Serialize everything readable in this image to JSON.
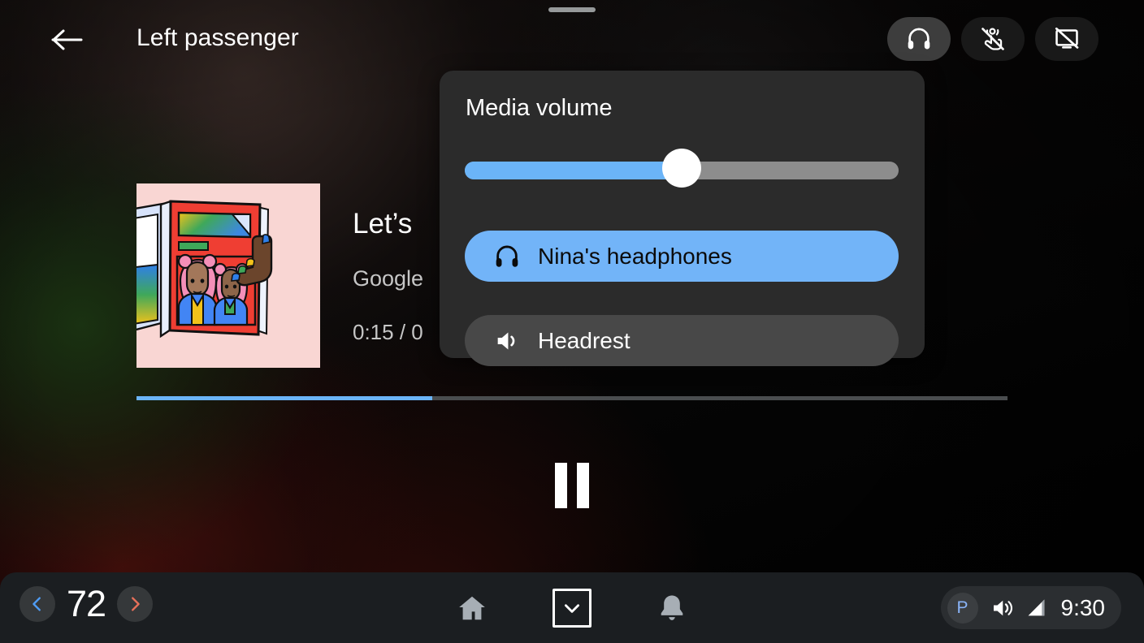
{
  "header": {
    "back_icon": "arrow-left-icon",
    "title": "Left passenger",
    "actions": [
      {
        "name": "headphones-toggle",
        "icon": "headphones-icon",
        "active": true
      },
      {
        "name": "touch-off-toggle",
        "icon": "touch-off-icon",
        "active": false
      },
      {
        "name": "screen-off-toggle",
        "icon": "screen-off-icon",
        "active": false
      }
    ]
  },
  "media": {
    "album_art_alt": "album-artwork",
    "track_title": "Let’s",
    "artist": "Google",
    "time": "0:15 / 0",
    "progress_percent": 34,
    "transport": {
      "state": "playing",
      "button": "pause-button"
    }
  },
  "volume_popup": {
    "title": "Media volume",
    "slider": {
      "value_percent": 50
    },
    "devices": [
      {
        "label": "Nina's headphones",
        "icon": "headphones-icon",
        "selected": true
      },
      {
        "label": "Headrest",
        "icon": "speaker-icon",
        "selected": false
      }
    ]
  },
  "bottom_bar": {
    "temperature": {
      "decrease_label": "‹",
      "value": "72",
      "increase_label": "›"
    },
    "nav": [
      {
        "name": "home-button",
        "icon": "home-icon"
      },
      {
        "name": "collapse-button",
        "icon": "chevron-down-icon",
        "focused": true
      },
      {
        "name": "notifications-button",
        "icon": "bell-icon"
      }
    ],
    "status": {
      "profile_initial": "P",
      "volume_icon": "volume-icon",
      "signal_icon": "signal-icon",
      "clock": "9:30"
    }
  },
  "colors": {
    "accent_blue": "#6bb4f8",
    "selected_blue": "#72b4f8",
    "panel_bg": "#2b2b2b",
    "bottom_bar_bg": "#1b1e21",
    "temp_down": "#6bb4f8",
    "temp_up": "#e8705a"
  }
}
